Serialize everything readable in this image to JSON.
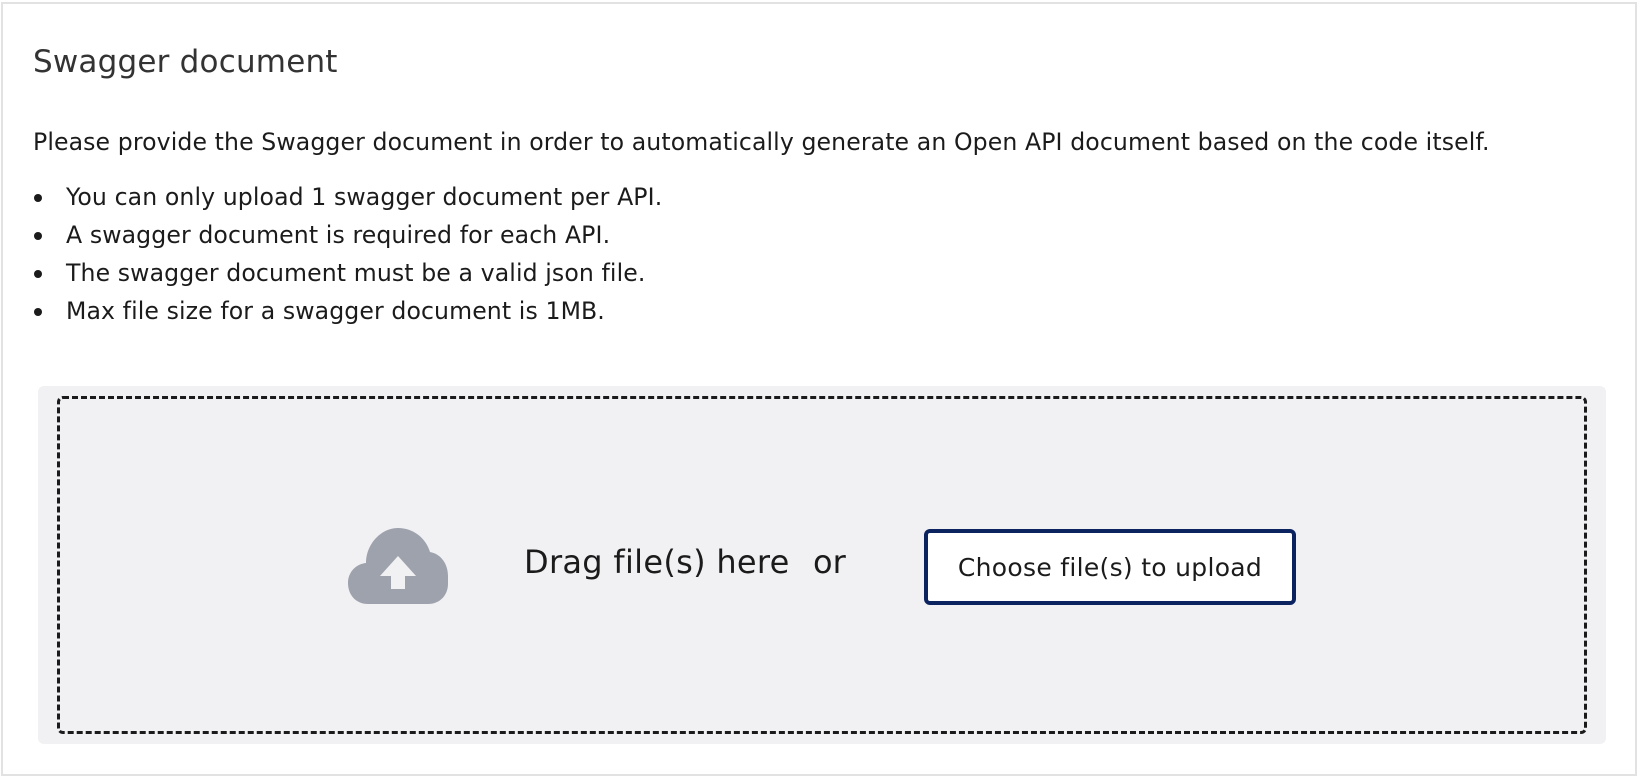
{
  "section": {
    "title": "Swagger document",
    "description": "Please provide the Swagger document in order to automatically generate an Open API document based on the code itself.",
    "rules": [
      "You can only upload 1 swagger document per API.",
      "A swagger document is required for each API.",
      "The swagger document must be a valid json file.",
      "Max file size for a swagger document is 1MB."
    ]
  },
  "upload": {
    "icon": "cloud-upload-icon",
    "drag_label": "Drag file(s) here",
    "or_label": "or",
    "choose_button_label": "Choose file(s) to upload"
  },
  "colors": {
    "button_border": "#0b2460",
    "dropzone_background": "#f1f1f3",
    "icon_gray": "#9ea2ad"
  }
}
